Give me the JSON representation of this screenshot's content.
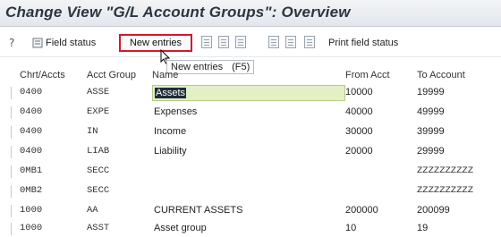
{
  "window": {
    "title": "Change View \"G/L Account Groups\": Overview"
  },
  "toolbar": {
    "field_status_label": "Field status",
    "new_entries_label": "New entries",
    "print_field_status_label": "Print field status",
    "icons": [
      "help-icon",
      "field-status-icon",
      "copy-icon",
      "save-icon",
      "undo-icon",
      "select-all-icon",
      "deselect-icon"
    ]
  },
  "tooltip": {
    "label": "New entries",
    "shortcut": "(F5)"
  },
  "table": {
    "headers": {
      "chart": "Chrt/Accts",
      "group": "Acct Group",
      "name": "Name",
      "from": "From Acct",
      "to": "To Account"
    },
    "rows": [
      {
        "chart": "0400",
        "group": "ASSE",
        "name": "Assets",
        "from": "10000",
        "to": "19999"
      },
      {
        "chart": "0400",
        "group": "EXPE",
        "name": "Expenses",
        "from": "40000",
        "to": "49999"
      },
      {
        "chart": "0400",
        "group": "IN",
        "name": "Income",
        "from": "30000",
        "to": "39999"
      },
      {
        "chart": "0400",
        "group": "LIAB",
        "name": "Liability",
        "from": "20000",
        "to": "29999"
      },
      {
        "chart": "0MB1",
        "group": "SECC",
        "name": "",
        "from": "",
        "to": "ZZZZZZZZZZ"
      },
      {
        "chart": "0MB2",
        "group": "SECC",
        "name": "",
        "from": "",
        "to": "ZZZZZZZZZZ"
      },
      {
        "chart": "1000",
        "group": "AA",
        "name": "CURRENT ASSETS",
        "from": "200000",
        "to": "200099"
      },
      {
        "chart": "1000",
        "group": "ASST",
        "name": "Asset group",
        "from": "10",
        "to": "19"
      }
    ]
  },
  "colors": {
    "accent_border": "#d3192a",
    "input_highlight": "#e3f0c4"
  }
}
